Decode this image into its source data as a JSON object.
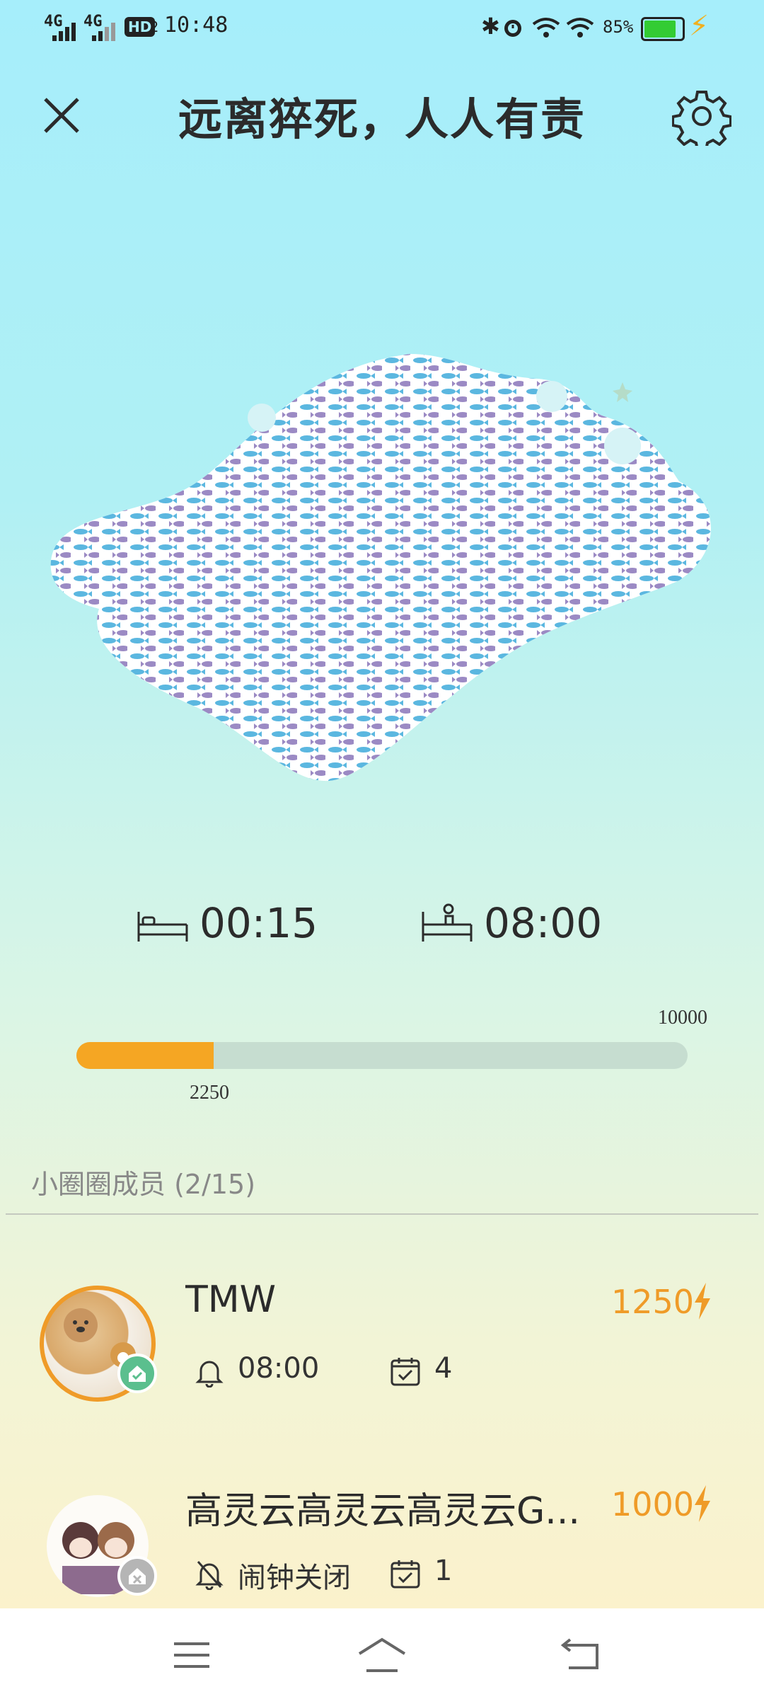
{
  "status_bar": {
    "signal1": "4G",
    "signal2": "4G",
    "hd": "HD",
    "hd_sub": "2",
    "time": "10:48",
    "battery": "85%"
  },
  "header": {
    "title": "远离猝死，人人有责"
  },
  "sleep": {
    "bed_time": "00:15",
    "wake_time": "08:00"
  },
  "progress": {
    "max_label": "10000",
    "current_label": "2250",
    "current": 2250,
    "max": 10000,
    "fill_color": "#f5a623",
    "track_color": "#c6ddd0"
  },
  "members": {
    "section_title": "小圈圈成员 (2/15)",
    "list": [
      {
        "name": "TMW",
        "points": "1250",
        "alarm": "08:00",
        "checkins": "4",
        "status": "online"
      },
      {
        "name": "高灵云高灵云高灵云G...",
        "points": "1000",
        "alarm": "闹钟关闭",
        "checkins": "1",
        "status": "offline"
      }
    ]
  },
  "colors": {
    "accent": "#ef9b28",
    "badge_ok": "#5bbf8e",
    "badge_off": "#b5b5b5"
  }
}
